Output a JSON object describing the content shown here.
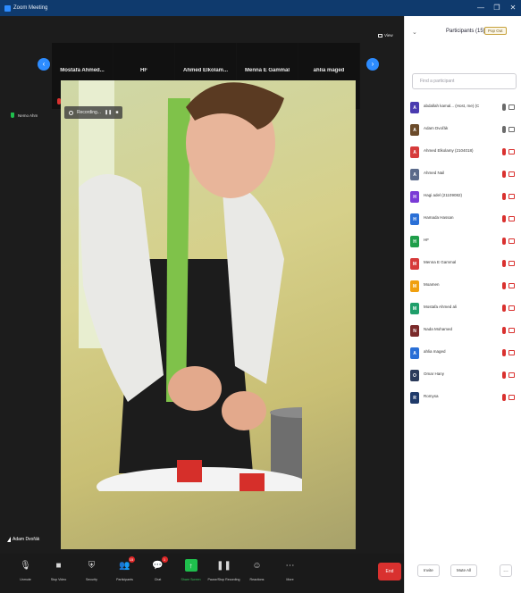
{
  "window": {
    "title": "Zoom Meeting",
    "controls": [
      "—",
      "❐",
      "✕"
    ]
  },
  "strip": {
    "participants": [
      "Mostafa Ahmed...",
      "HF",
      "Ahmed Elkolam...",
      "Menna E Gammal",
      "ahlia maged"
    ]
  },
  "view_label": "View",
  "side_label": "Nemo Ahm",
  "recording": {
    "label": "Recording..."
  },
  "speaker": {
    "name": "Adam Dvořák"
  },
  "toolbar": {
    "items": [
      {
        "icon": "mic-icon",
        "label": "Unmute",
        "glyph": "🎙"
      },
      {
        "icon": "video-icon",
        "label": "Stop Video",
        "glyph": "■"
      },
      {
        "icon": "shield-icon",
        "label": "Security",
        "glyph": "⛨"
      },
      {
        "icon": "participants-icon",
        "label": "Participants",
        "glyph": "👥",
        "badge": "15"
      },
      {
        "icon": "chat-icon",
        "label": "Chat",
        "glyph": "💬",
        "badge": "1"
      },
      {
        "icon": "share-screen-icon",
        "label": "Share Screen",
        "glyph": "↑"
      },
      {
        "icon": "record-icon",
        "label": "Pause/Stop Recording",
        "glyph": "❚❚"
      },
      {
        "icon": "reactions-icon",
        "label": "Reactions",
        "glyph": "☺"
      },
      {
        "icon": "more-icon",
        "label": "More",
        "glyph": "⋯"
      }
    ],
    "end_label": "End"
  },
  "panel": {
    "title": "Participants (15)",
    "popout": "Pop Out",
    "search_placeholder": "Find a participant",
    "participants": [
      {
        "name": "abdallah kamal... (Host, me) (C",
        "initial": "A",
        "color": "#4a3bb0",
        "mic": "on",
        "cam": "on"
      },
      {
        "name": "Adam Dvořák",
        "initial": "A",
        "color": "#6b4b2a",
        "mic": "on",
        "cam": "on"
      },
      {
        "name": "Ahmed Elkolamy (2104018)",
        "initial": "A",
        "color": "#d63b3b",
        "mic": "muted",
        "cam": "muted"
      },
      {
        "name": "Ahmed Nail",
        "initial": "A",
        "color": "#5a6a8a",
        "mic": "muted",
        "cam": "muted"
      },
      {
        "name": "Hagi adel (21109082)",
        "initial": "H",
        "color": "#7a3bd6",
        "mic": "muted",
        "cam": "muted"
      },
      {
        "name": "Hamada Hassan",
        "initial": "H",
        "color": "#2a6fd6",
        "mic": "muted",
        "cam": "muted"
      },
      {
        "name": "HF",
        "initial": "H",
        "color": "#1f9e4a",
        "mic": "muted",
        "cam": "muted"
      },
      {
        "name": "Menna E Gammal",
        "initial": "M",
        "color": "#d63b3b",
        "mic": "muted",
        "cam": "muted"
      },
      {
        "name": "Moamen",
        "initial": "M",
        "color": "#f0a010",
        "mic": "muted",
        "cam": "muted"
      },
      {
        "name": "Mostafa Ahmed ali",
        "initial": "M",
        "color": "#1f9e6a",
        "mic": "muted",
        "cam": "muted"
      },
      {
        "name": "Nada Mohamed",
        "initial": "N",
        "color": "#7a2a2a",
        "mic": "muted",
        "cam": "muted"
      },
      {
        "name": "ahlia maged",
        "initial": "A",
        "color": "#2a6fd6",
        "mic": "muted",
        "cam": "muted"
      },
      {
        "name": "Omar Hany",
        "initial": "O",
        "color": "#2a3a5a",
        "mic": "muted",
        "cam": "muted"
      },
      {
        "name": "Romysa",
        "initial": "R",
        "color": "#1f3a6a",
        "mic": "muted",
        "cam": "muted"
      }
    ],
    "footer": {
      "invite": "Invite",
      "mute_all": "Mute All",
      "more": "…"
    }
  }
}
